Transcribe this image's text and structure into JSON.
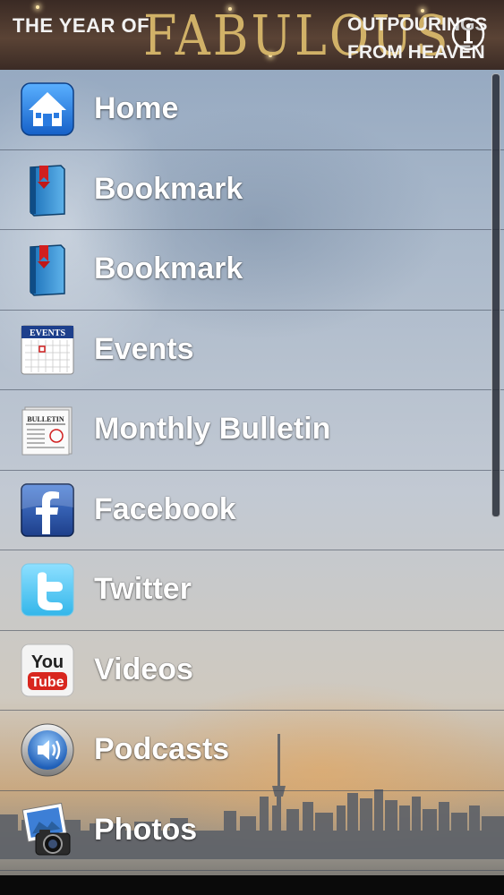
{
  "banner": {
    "left_text": "THE YEAR OF",
    "title": "FABULOUS",
    "right_line1": "OUTPOURINGS",
    "right_line2": "FROM HEAVEN",
    "info_icon": "info-icon"
  },
  "menu": {
    "items": [
      {
        "label": "Home",
        "icon": "home-icon"
      },
      {
        "label": "Bookmark",
        "icon": "bookmark-book-icon"
      },
      {
        "label": "Bookmark",
        "icon": "bookmark-book-icon"
      },
      {
        "label": "Events",
        "icon": "events-calendar-icon",
        "icon_text": "EVENTS"
      },
      {
        "label": "Monthly Bulletin",
        "icon": "bulletin-newspaper-icon",
        "icon_text": "BULLETIN"
      },
      {
        "label": "Facebook",
        "icon": "facebook-icon"
      },
      {
        "label": "Twitter",
        "icon": "twitter-icon"
      },
      {
        "label": "Videos",
        "icon": "youtube-icon",
        "icon_text": "You",
        "icon_text2": "Tube"
      },
      {
        "label": "Podcasts",
        "icon": "podcast-speaker-icon"
      },
      {
        "label": "Photos",
        "icon": "photos-camera-icon"
      }
    ]
  },
  "colors": {
    "banner_bg": "#4a372d",
    "title_gold": "#d8b86b",
    "label_text": "#ffffff",
    "divider": "#3c4655"
  }
}
